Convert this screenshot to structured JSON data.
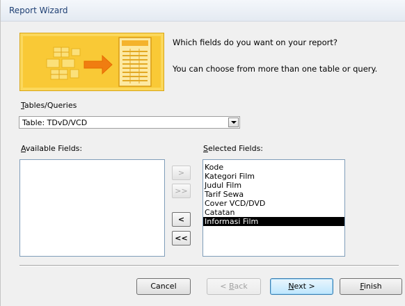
{
  "window": {
    "title": "Report Wizard"
  },
  "header": {
    "question": "Which fields do you want on your report?",
    "hint": "You can choose from more than one table or query."
  },
  "tables": {
    "label": "Tables/Queries",
    "selected": "Table: TDvD/VCD"
  },
  "available": {
    "label": "Available Fields:",
    "items": []
  },
  "selected_fields": {
    "label": "Selected Fields:",
    "items": [
      "Kode",
      "Kategori Film",
      "Judul Film",
      "Tarif Sewa",
      "Cover VCD/DVD",
      "Catatan",
      "Informasi Film"
    ],
    "highlighted_index": 6
  },
  "move_buttons": {
    "add_one": ">",
    "add_all": ">>",
    "remove_one": "<",
    "remove_all": "<<"
  },
  "footer": {
    "cancel": "Cancel",
    "back": "< Back",
    "next": "Next >",
    "finish": "Finish"
  },
  "colors": {
    "banner": "#f9c936",
    "highlight": "#000000",
    "title_text": "#1e3f73"
  }
}
